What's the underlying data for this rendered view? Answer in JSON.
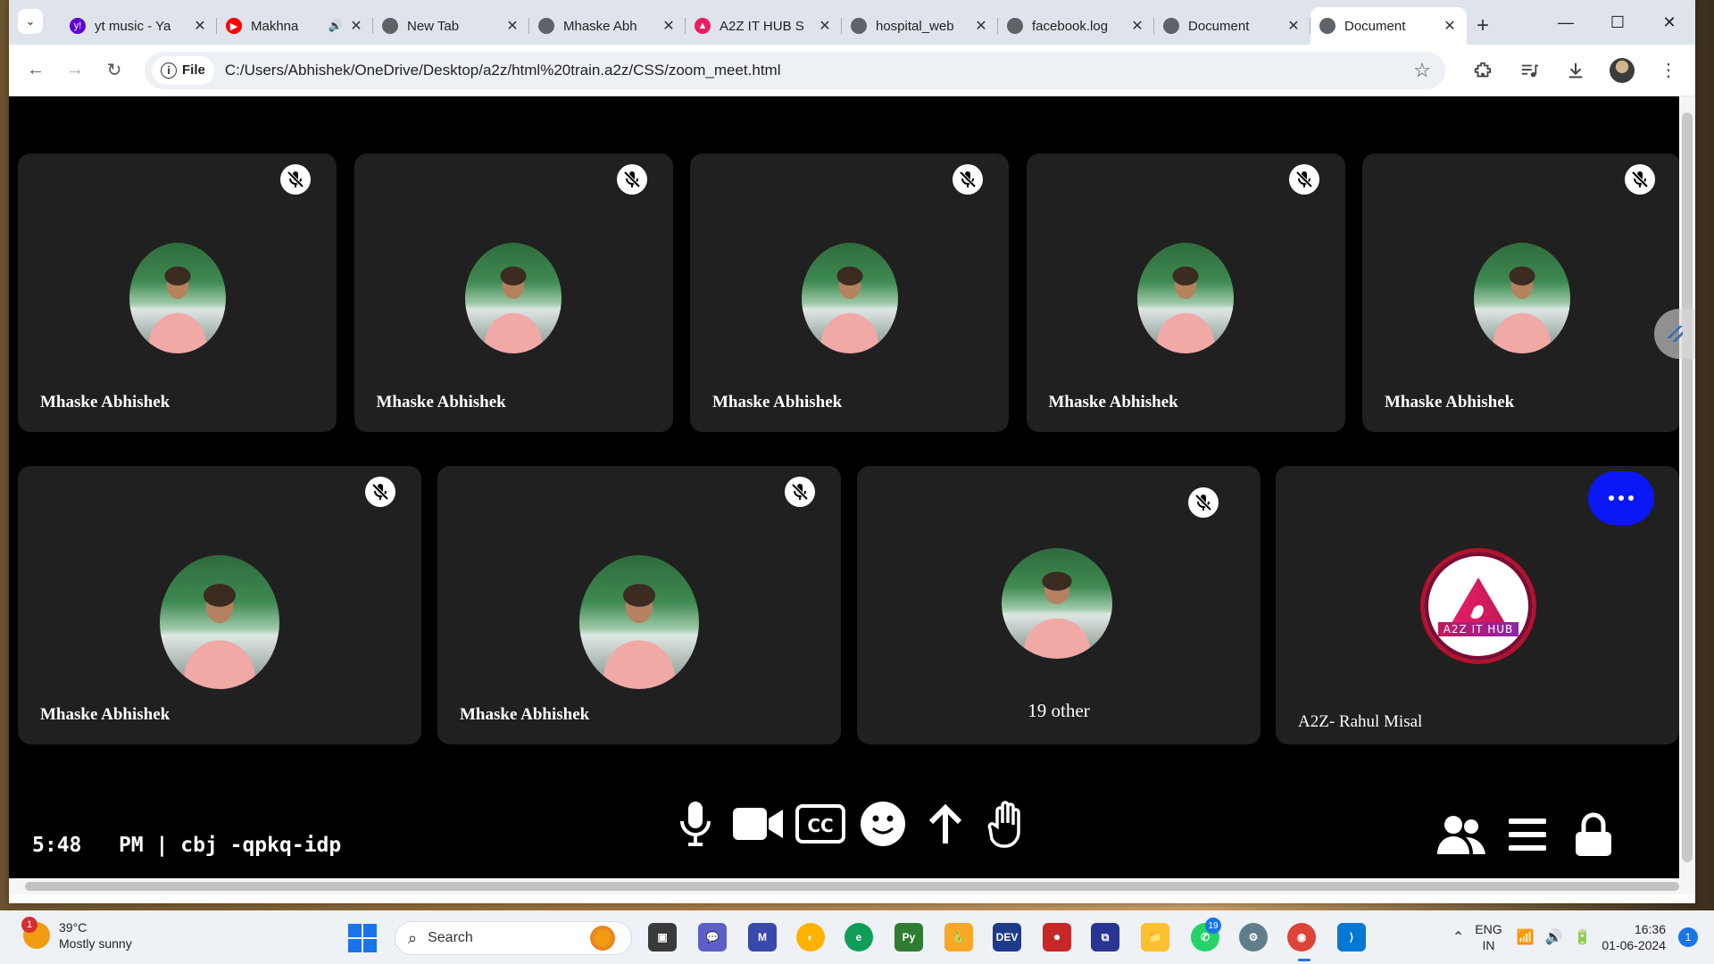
{
  "browser": {
    "tabs": [
      {
        "title": "yt music - Ya",
        "icon": "yahoo-icon",
        "icon_color": "#6001d2",
        "icon_text": "y!",
        "active": false,
        "audio": false
      },
      {
        "title": "Makhna",
        "icon": "youtube-icon",
        "icon_color": "#ff0000",
        "icon_text": "▶",
        "active": false,
        "audio": true
      },
      {
        "title": "New Tab",
        "icon": "globe-icon",
        "icon_color": "#5f6368",
        "icon_text": "",
        "active": false,
        "audio": false
      },
      {
        "title": "Mhaske Abh",
        "icon": "globe-icon",
        "icon_color": "#5f6368",
        "icon_text": "",
        "active": false,
        "audio": false
      },
      {
        "title": "A2Z IT HUB S",
        "icon": "a2z-icon",
        "icon_color": "#e91e63",
        "icon_text": "▲",
        "active": false,
        "audio": false
      },
      {
        "title": "hospital_web",
        "icon": "globe-icon",
        "icon_color": "#5f6368",
        "icon_text": "",
        "active": false,
        "audio": false
      },
      {
        "title": "facebook.log",
        "icon": "globe-icon",
        "icon_color": "#5f6368",
        "icon_text": "",
        "active": false,
        "audio": false
      },
      {
        "title": "Document",
        "icon": "globe-icon",
        "icon_color": "#5f6368",
        "icon_text": "",
        "active": false,
        "audio": false
      },
      {
        "title": "Document",
        "icon": "globe-icon",
        "icon_color": "#5f6368",
        "icon_text": "",
        "active": true,
        "audio": false
      }
    ],
    "site_chip": "File",
    "url": "C:/Users/Abhishek/OneDrive/Desktop/a2z/html%20train.a2z/CSS/zoom_meet.html"
  },
  "meeting": {
    "row1": [
      {
        "name": "Mhaske Abhishek"
      },
      {
        "name": "Mhaske Abhishek"
      },
      {
        "name": "Mhaske Abhishek"
      },
      {
        "name": "Mhaske Abhishek"
      },
      {
        "name": "Mhaske Abhishek"
      }
    ],
    "row2": [
      {
        "name": "Mhaske Abhishek"
      },
      {
        "name": "Mhaske Abhishek"
      }
    ],
    "others_label": "19 other",
    "host_name": "A2Z- Rahul Misal",
    "logo_text": "A2Z IT HUB",
    "time": "5:48",
    "period": "PM",
    "separator": "|",
    "meeting_code": "cbj -qpkq-idp",
    "more_button_color": "#0b17f5"
  },
  "taskbar": {
    "weather_temp": "39°C",
    "weather_desc": "Mostly sunny",
    "weather_badge": "1",
    "search_placeholder": "Search",
    "whatsapp_badge": "19",
    "lang_line1": "ENG",
    "lang_line2": "IN",
    "time": "16:36",
    "date": "01-06-2024",
    "notification_count": "1"
  }
}
